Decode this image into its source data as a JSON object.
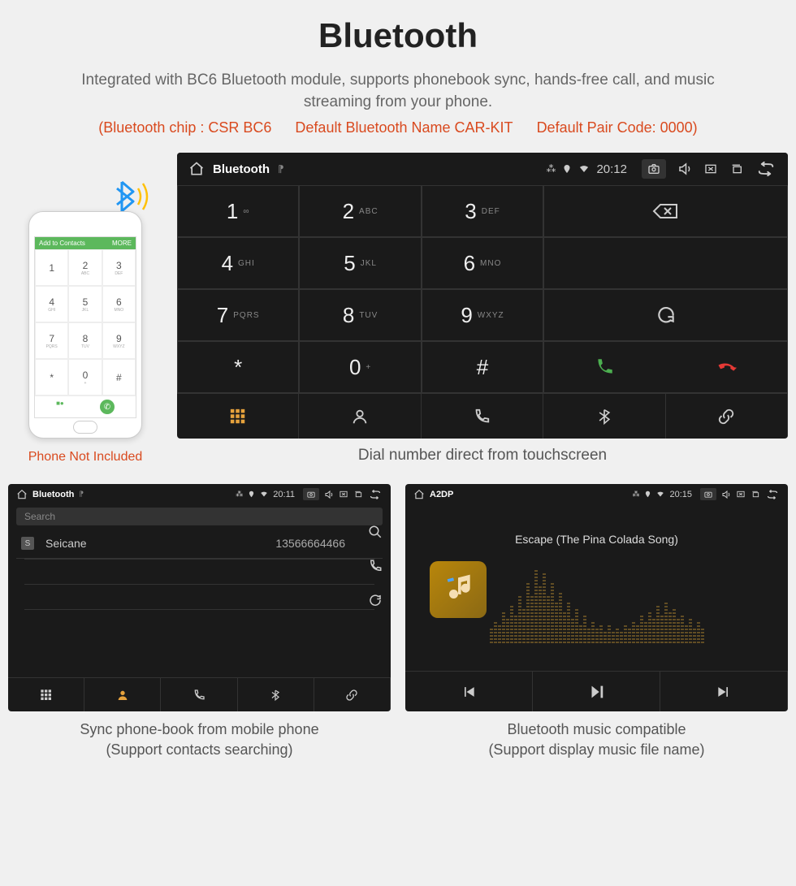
{
  "header": {
    "title": "Bluetooth",
    "subtitle": "Integrated with BC6 Bluetooth module, supports phonebook sync, hands-free call, and music streaming from your phone.",
    "spec_chip": "(Bluetooth chip : CSR BC6",
    "spec_name": "Default Bluetooth Name CAR-KIT",
    "spec_pair": "Default Pair Code: 0000)"
  },
  "phone": {
    "header_left": "Add to Contacts",
    "header_right": "MORE",
    "caption": "Phone Not Included",
    "keys": [
      "1",
      "2",
      "3",
      "4",
      "5",
      "6",
      "7",
      "8",
      "9",
      "*",
      "0",
      "#"
    ],
    "subs": [
      "",
      "ABC",
      "DEF",
      "GHI",
      "JKL",
      "MNO",
      "PQRS",
      "TUV",
      "WXYZ",
      "",
      "+",
      ""
    ]
  },
  "dialer": {
    "statusbar": {
      "app": "Bluetooth",
      "time": "20:12"
    },
    "keys": [
      {
        "n": "1",
        "s": "∞"
      },
      {
        "n": "2",
        "s": "ABC"
      },
      {
        "n": "3",
        "s": "DEF"
      },
      {
        "n": "4",
        "s": "GHI"
      },
      {
        "n": "5",
        "s": "JKL"
      },
      {
        "n": "6",
        "s": "MNO"
      },
      {
        "n": "7",
        "s": "PQRS"
      },
      {
        "n": "8",
        "s": "TUV"
      },
      {
        "n": "9",
        "s": "WXYZ"
      },
      {
        "n": "*",
        "s": ""
      },
      {
        "n": "0",
        "s": "+"
      },
      {
        "n": "#",
        "s": ""
      }
    ],
    "caption": "Dial number direct from touchscreen"
  },
  "phonebook": {
    "statusbar": {
      "app": "Bluetooth",
      "time": "20:11"
    },
    "search": "Search",
    "contact": {
      "badge": "S",
      "name": "Seicane",
      "number": "13566664466"
    },
    "caption1": "Sync phone-book from mobile phone",
    "caption2": "(Support contacts searching)"
  },
  "music": {
    "statusbar": {
      "app": "A2DP",
      "time": "20:15"
    },
    "track": "Escape (The Pina Colada Song)",
    "caption1": "Bluetooth music compatible",
    "caption2": "(Support display music file name)"
  }
}
